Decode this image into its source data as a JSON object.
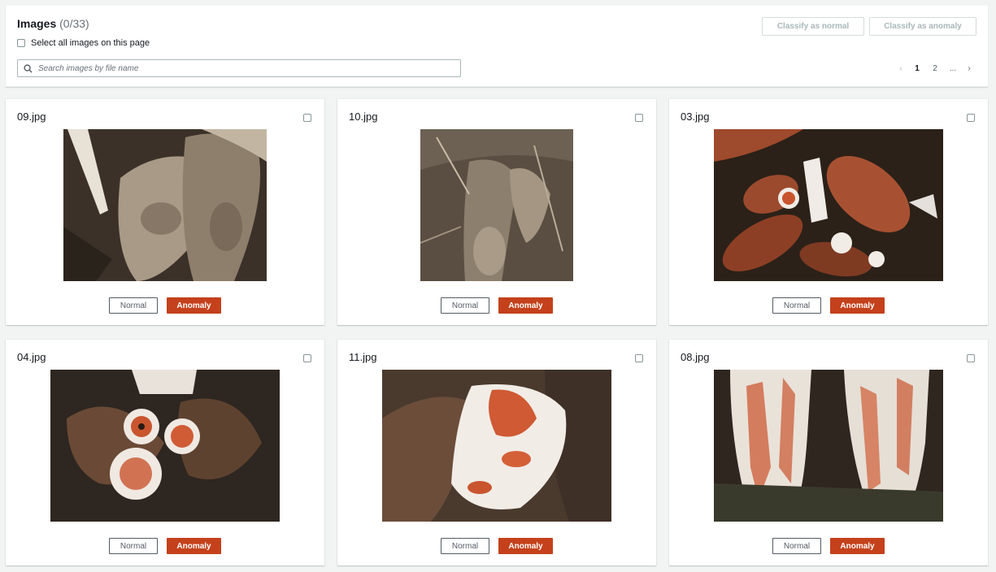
{
  "header": {
    "title": "Images",
    "count": "(0/33)",
    "select_all_label": "Select all images on this page",
    "search_placeholder": "Search images by file name",
    "classify_normal_label": "Classify as normal",
    "classify_anomaly_label": "Classify as anomaly"
  },
  "pagination": {
    "prev": "‹",
    "pages": [
      "1",
      "2"
    ],
    "ellipsis": "...",
    "next": "›",
    "current": "1"
  },
  "cards": [
    {
      "filename": "09.jpg",
      "normal_label": "Normal",
      "anomaly_label": "Anomaly"
    },
    {
      "filename": "10.jpg",
      "normal_label": "Normal",
      "anomaly_label": "Anomaly"
    },
    {
      "filename": "03.jpg",
      "normal_label": "Normal",
      "anomaly_label": "Anomaly"
    },
    {
      "filename": "04.jpg",
      "normal_label": "Normal",
      "anomaly_label": "Anomaly"
    },
    {
      "filename": "11.jpg",
      "normal_label": "Normal",
      "anomaly_label": "Anomaly"
    },
    {
      "filename": "08.jpg",
      "normal_label": "Normal",
      "anomaly_label": "Anomaly"
    }
  ],
  "colors": {
    "anomaly_accent": "#c4411b",
    "background": "#f2f3f3"
  }
}
